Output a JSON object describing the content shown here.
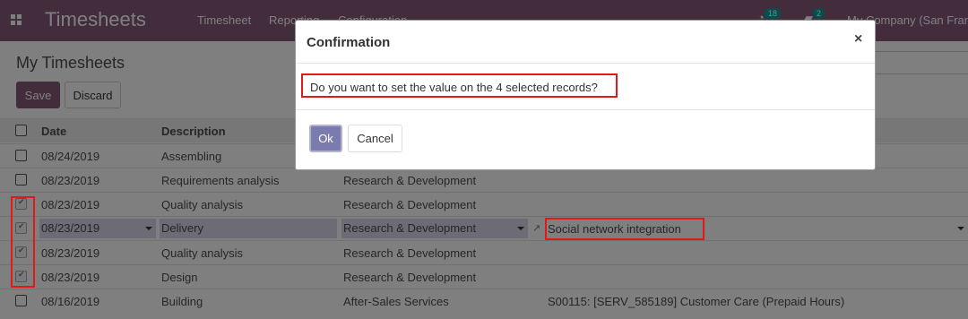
{
  "navbar": {
    "brand": "Timesheets",
    "menu": [
      "Timesheet",
      "Reporting",
      "Configuration"
    ],
    "activity_count": "18",
    "message_count": "2",
    "company": "My Company (San Fran"
  },
  "control_panel": {
    "title": "My Timesheets",
    "save_label": "Save",
    "discard_label": "Discard"
  },
  "table": {
    "columns": [
      "Date",
      "Description"
    ],
    "rows": [
      {
        "date": "08/24/2019",
        "description": "Assembling",
        "project": "",
        "task": "",
        "checked": false
      },
      {
        "date": "08/23/2019",
        "description": "Requirements analysis",
        "project": "Research & Development",
        "task": "",
        "checked": false
      },
      {
        "date": "08/23/2019",
        "description": "Quality analysis",
        "project": "Research & Development",
        "task": "",
        "checked": true
      },
      {
        "date": "08/23/2019",
        "description": "Delivery",
        "project": "Research & Development",
        "task": "Social network integration",
        "checked": true
      },
      {
        "date": "08/23/2019",
        "description": "Quality analysis",
        "project": "Research & Development",
        "task": "",
        "checked": true
      },
      {
        "date": "08/23/2019",
        "description": "Design",
        "project": "Research & Development",
        "task": "",
        "checked": true
      },
      {
        "date": "08/16/2019",
        "description": "Building",
        "project": "After-Sales Services",
        "task": "S00115: [SERV_585189] Customer Care (Prepaid Hours)",
        "checked": false
      }
    ]
  },
  "modal": {
    "title": "Confirmation",
    "close": "×",
    "message": "Do you want to set the value on the 4 selected records?",
    "ok_label": "Ok",
    "cancel_label": "Cancel"
  }
}
